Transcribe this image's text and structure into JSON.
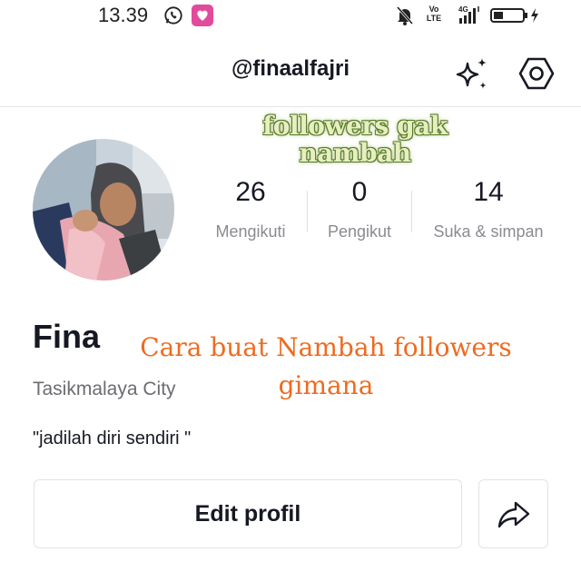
{
  "status_bar": {
    "time": "13.39",
    "volte_line1": "Vo",
    "volte_line2": "LTE",
    "network": "4G"
  },
  "header": {
    "username": "@finaalfajri",
    "icons": [
      "sparkle-icon",
      "settings-icon"
    ]
  },
  "overlay": {
    "green_line1": "followers gak",
    "green_line2": "nambah",
    "orange_line1": "Cara buat Nambah followers",
    "orange_line2": "gimana"
  },
  "stats": [
    {
      "value": "26",
      "label": "Mengikuti"
    },
    {
      "value": "0",
      "label": "Pengikut"
    },
    {
      "value": "14",
      "label": "Suka & simpan"
    }
  ],
  "profile": {
    "display_name": "Fina",
    "location": "Tasikmalaya City",
    "bio": "\"jadilah diri sendiri \""
  },
  "actions": {
    "edit_label": "Edit profil",
    "share_icon": "share-icon"
  },
  "colors": {
    "overlay_green": "#e7efc0",
    "overlay_orange": "#ee6b20",
    "muted_text": "#8a8b91"
  }
}
